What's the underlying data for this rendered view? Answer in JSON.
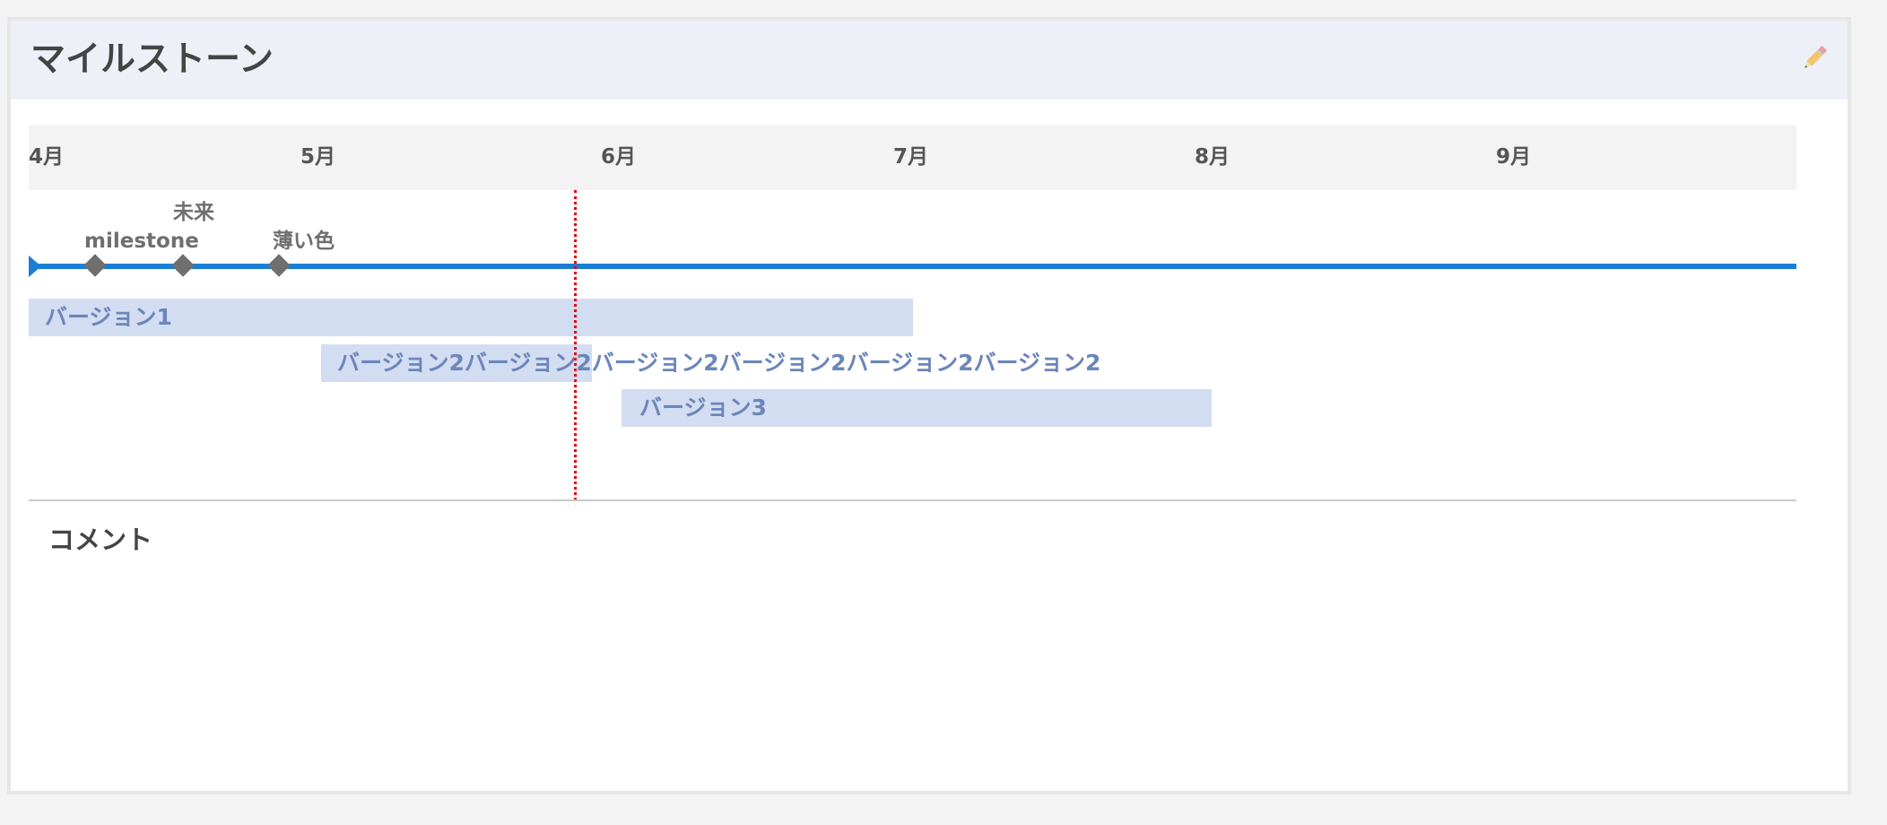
{
  "panel": {
    "title": "マイルストーン",
    "edit_icon": "pencil-icon"
  },
  "timeline": {
    "months": [
      "4月",
      "5月",
      "6月",
      "7月",
      "8月",
      "9月"
    ]
  },
  "milestones": [
    {
      "label": "milestone"
    },
    {
      "label": "未来"
    },
    {
      "label": "薄い色"
    }
  ],
  "versions": [
    {
      "label": "バージョン1"
    },
    {
      "label": "バージョン2バージョン2バージョン2バージョン2バージョン2バージョン2"
    },
    {
      "label": "バージョン3"
    }
  ],
  "comment": {
    "label": "コメント"
  },
  "colors": {
    "header_bg": "#eef0f8",
    "milestone_line": "#1a7fd4",
    "milestone_marker": "#6f6f6f",
    "version_bar": "#d3ddf1",
    "version_text": "#6c86ba",
    "today_line": "#e8000b"
  }
}
